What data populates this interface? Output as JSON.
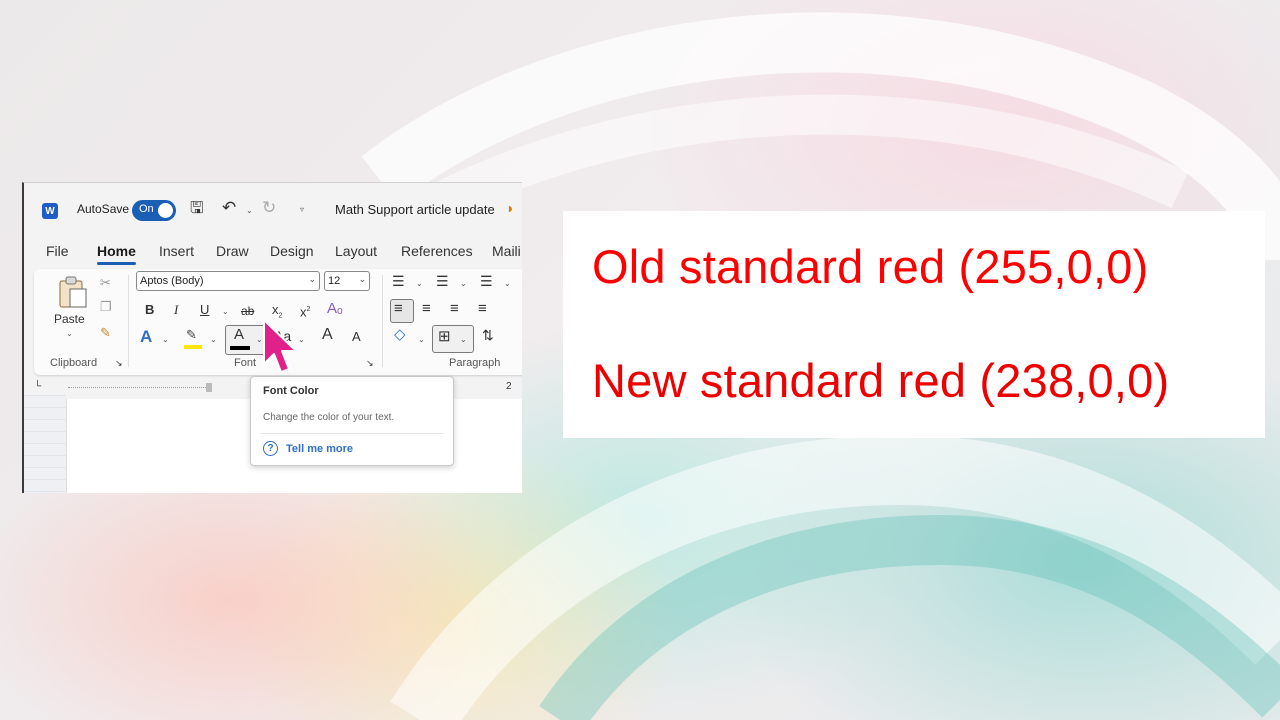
{
  "window": {
    "autosave_label": "AutoSave",
    "toggle_state": "On",
    "doc_title": "Math Support article update"
  },
  "tabs": [
    {
      "label": "File"
    },
    {
      "label": "Home",
      "active": true
    },
    {
      "label": "Insert"
    },
    {
      "label": "Draw"
    },
    {
      "label": "Design"
    },
    {
      "label": "Layout"
    },
    {
      "label": "References"
    },
    {
      "label": "Maili"
    }
  ],
  "ribbon": {
    "clipboard": {
      "paste_label": "Paste",
      "group_label": "Clipboard"
    },
    "font": {
      "font_name": "Aptos (Body)",
      "font_size": "12",
      "group_label": "Font",
      "bold": "B",
      "italic": "I",
      "underline": "U",
      "strike": "ab",
      "subscript": "x",
      "subscript_mark": "2",
      "superscript": "x",
      "superscript_mark": "2",
      "font_color_glyph": "A",
      "font_color_bar": "#000000",
      "highlight_bar": "#ffe600",
      "change_case": "Aa",
      "grow": "A",
      "shrink": "A"
    },
    "paragraph": {
      "group_label": "Paragraph"
    }
  },
  "ruler": {
    "mark": "2"
  },
  "tooltip": {
    "title": "Font Color",
    "description": "Change the color of your text.",
    "link": "Tell me more",
    "help_glyph": "?"
  },
  "comparison": {
    "old_text": "Old standard red (255,0,0)",
    "old_color": "#ff0000",
    "new_text": "New standard red (238,0,0)",
    "new_color": "#ee0000"
  },
  "colors": {
    "accent": "#1a5fb4",
    "word_brand": "#1e5dc9",
    "cursor": "#e0218a"
  }
}
